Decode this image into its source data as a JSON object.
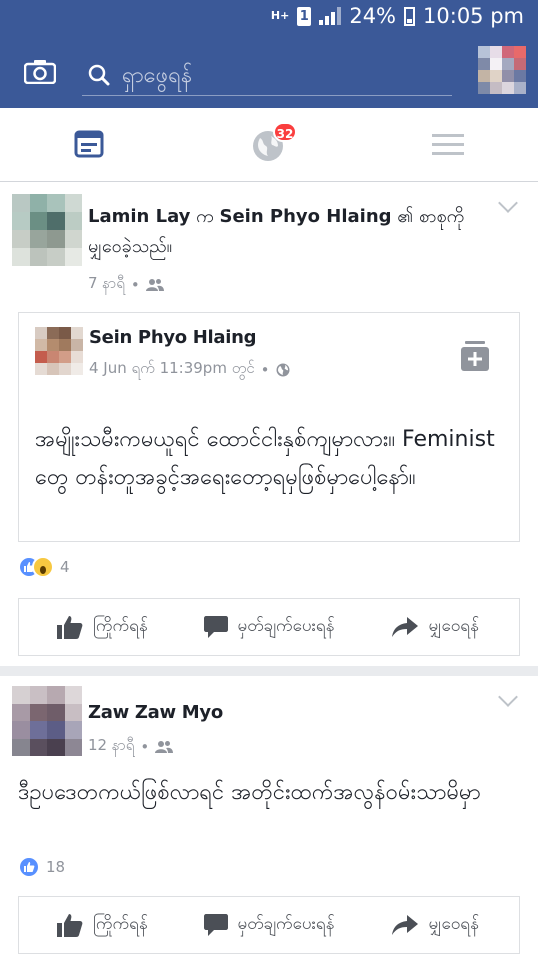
{
  "status": {
    "network": "H+",
    "sim": "1",
    "battery": "24%",
    "time": "10:05 pm"
  },
  "search": {
    "placeholder": "ရှာဖွေရန်"
  },
  "tabs": {
    "notifications_badge": "32"
  },
  "post1": {
    "actor": "Lamin Lay",
    "verb_pre": " က ",
    "target": "Sein Phyo Hlaing",
    "verb_post": " ၏ စာစုကို မျှဝေခဲ့သည်။",
    "time": "7 နာရီ",
    "shared": {
      "author": "Sein Phyo Hlaing",
      "time": "4 Jun ရက် 11:39pm တွင်",
      "text": "အမျိုးသမီးကမယူရင် ထောင်ငါးနှစ်ကျမှာလား။ Feminist တွေ တန်းတူအခွင့်အရေးတော့ရမှဖြစ်မှာပေါ့နော်။"
    },
    "reaction_count": "4",
    "actions": {
      "like": "ကြိုက်ရန်",
      "comment": "မှတ်ချက်ပေးရန်",
      "share": "မျှဝေရန်"
    }
  },
  "post2": {
    "author": "Zaw Zaw Myo",
    "time": "12 နာရီ",
    "text": "ဒီဥပဒေတကယ်ဖြစ်လာရင် အတိုင်းထက်အလွန်ဝမ်းသာမိမှာ",
    "reaction_count": "18",
    "actions": {
      "like": "ကြိုက်ရန်",
      "comment": "မှတ်ချက်ပေးရန်",
      "share": "မျှဝေရန်"
    }
  },
  "colors": {
    "brand": "#3b5998",
    "badge": "#fa3e3e",
    "like": "#5890ff"
  }
}
